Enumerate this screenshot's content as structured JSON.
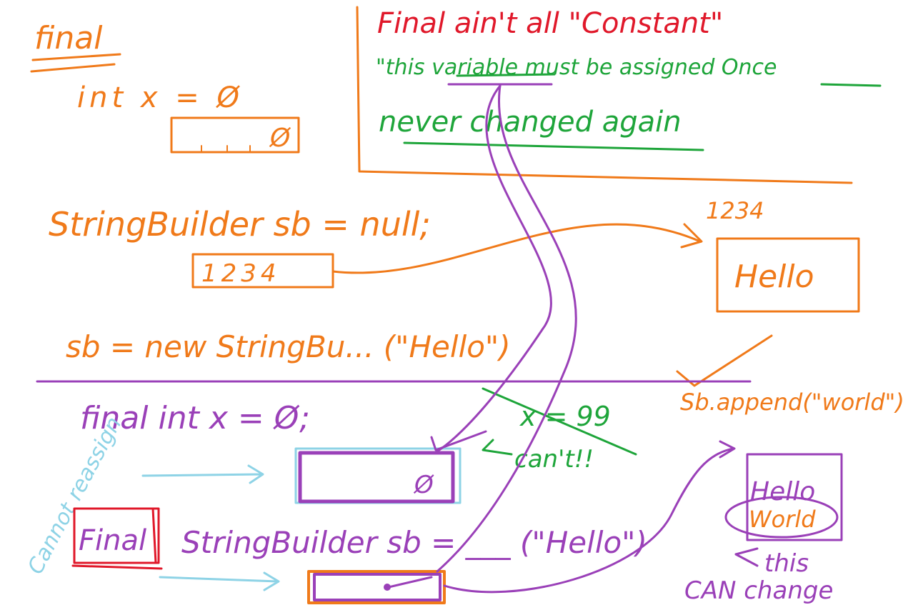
{
  "colors": {
    "orange": "#f07a1a",
    "green": "#1ea53a",
    "red": "#e0182a",
    "purple": "#9a40b8",
    "sky": "#8ed3e6"
  },
  "top_left": {
    "title": "final",
    "declaration": "int   x = Ø",
    "box_value": "Ø"
  },
  "note": {
    "headline": "Final  ain't  all \"Constant\"",
    "line1_prefix": "\"this ",
    "line1_variable": "variable",
    "line1_middle": " must be assigned ",
    "line1_once": "Once",
    "line2": "never changed again"
  },
  "stringbuilder": {
    "declaration": "StringBuilder sb = null;",
    "address_box": "1234",
    "object_label": "1234",
    "object_value": "Hello",
    "assignment": "sb = new StringBu... (\"Hello\")",
    "append": "Sb.append(\"world\")"
  },
  "bottom": {
    "final_int": "final  int   x = Ø;",
    "reassign": "x = 99",
    "cant": "can't!!",
    "box_value": "Ø",
    "side_note": "Cannot reassign",
    "final_word": "Final",
    "sb_declaration": "StringBuilder sb = ___ (\"Hello\")",
    "obj_hello": "Hello",
    "obj_world": "World",
    "this_can": "this",
    "can_change": "CAN change"
  }
}
